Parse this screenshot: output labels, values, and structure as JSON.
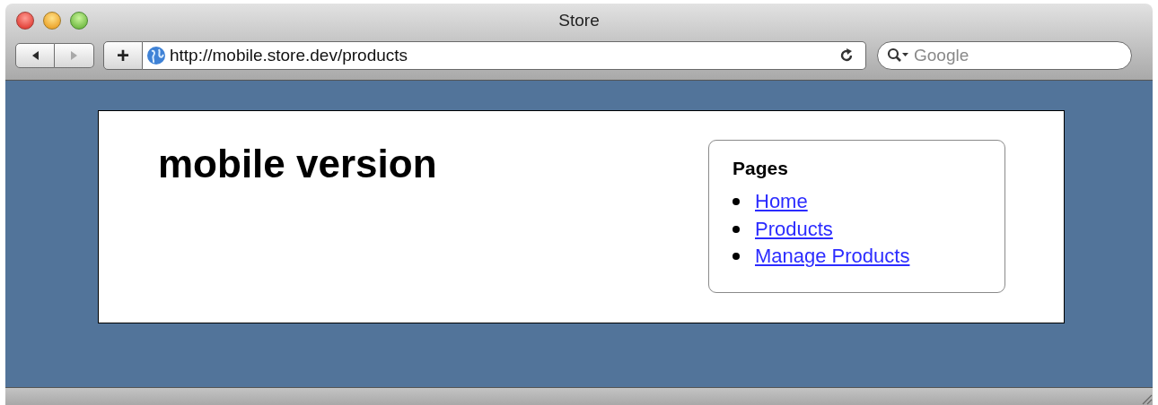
{
  "window": {
    "title": "Store"
  },
  "toolbar": {
    "nav_buttons": [
      {
        "kind": "back",
        "disabled": false
      },
      {
        "kind": "forward",
        "disabled": true
      }
    ],
    "add_button": "+",
    "address": "http://mobile.store.dev/products",
    "search": {
      "placeholder": "Google"
    }
  },
  "page": {
    "heading": "mobile version",
    "sidebar": {
      "title": "Pages",
      "links": [
        "Home",
        "Products",
        "Manage Products"
      ]
    }
  }
}
